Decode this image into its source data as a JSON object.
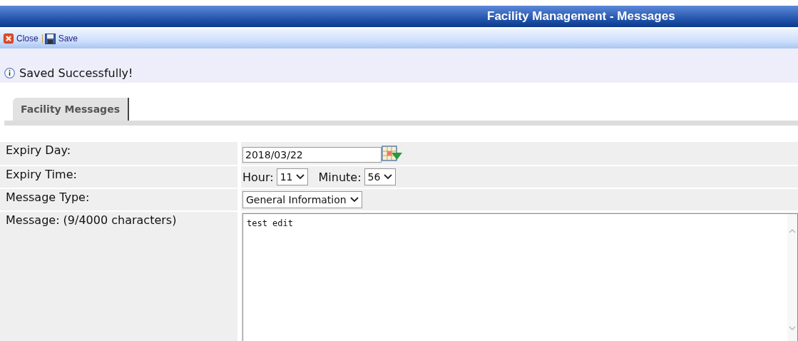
{
  "window": {
    "title": "Facility Management - Messages"
  },
  "toolbar": {
    "buttons": [
      {
        "kind": "close",
        "label": "Close"
      },
      {
        "kind": "save",
        "label": "Save"
      }
    ]
  },
  "notice": {
    "text": "Saved Successfully!"
  },
  "tabs": [
    {
      "label": "Facility Messages",
      "selected": true
    }
  ],
  "form": {
    "expiry_day": {
      "label": "Expiry Day:",
      "value": "2018/03/22"
    },
    "expiry_time": {
      "label": "Expiry Time:",
      "hour_label": "Hour:",
      "hour": "11",
      "minute_label": "Minute:",
      "minute": "56"
    },
    "message_type": {
      "label": "Message Type:",
      "value": "General Information"
    },
    "message": {
      "label": "Message: (9/4000 characters)",
      "value": "test edit"
    }
  }
}
